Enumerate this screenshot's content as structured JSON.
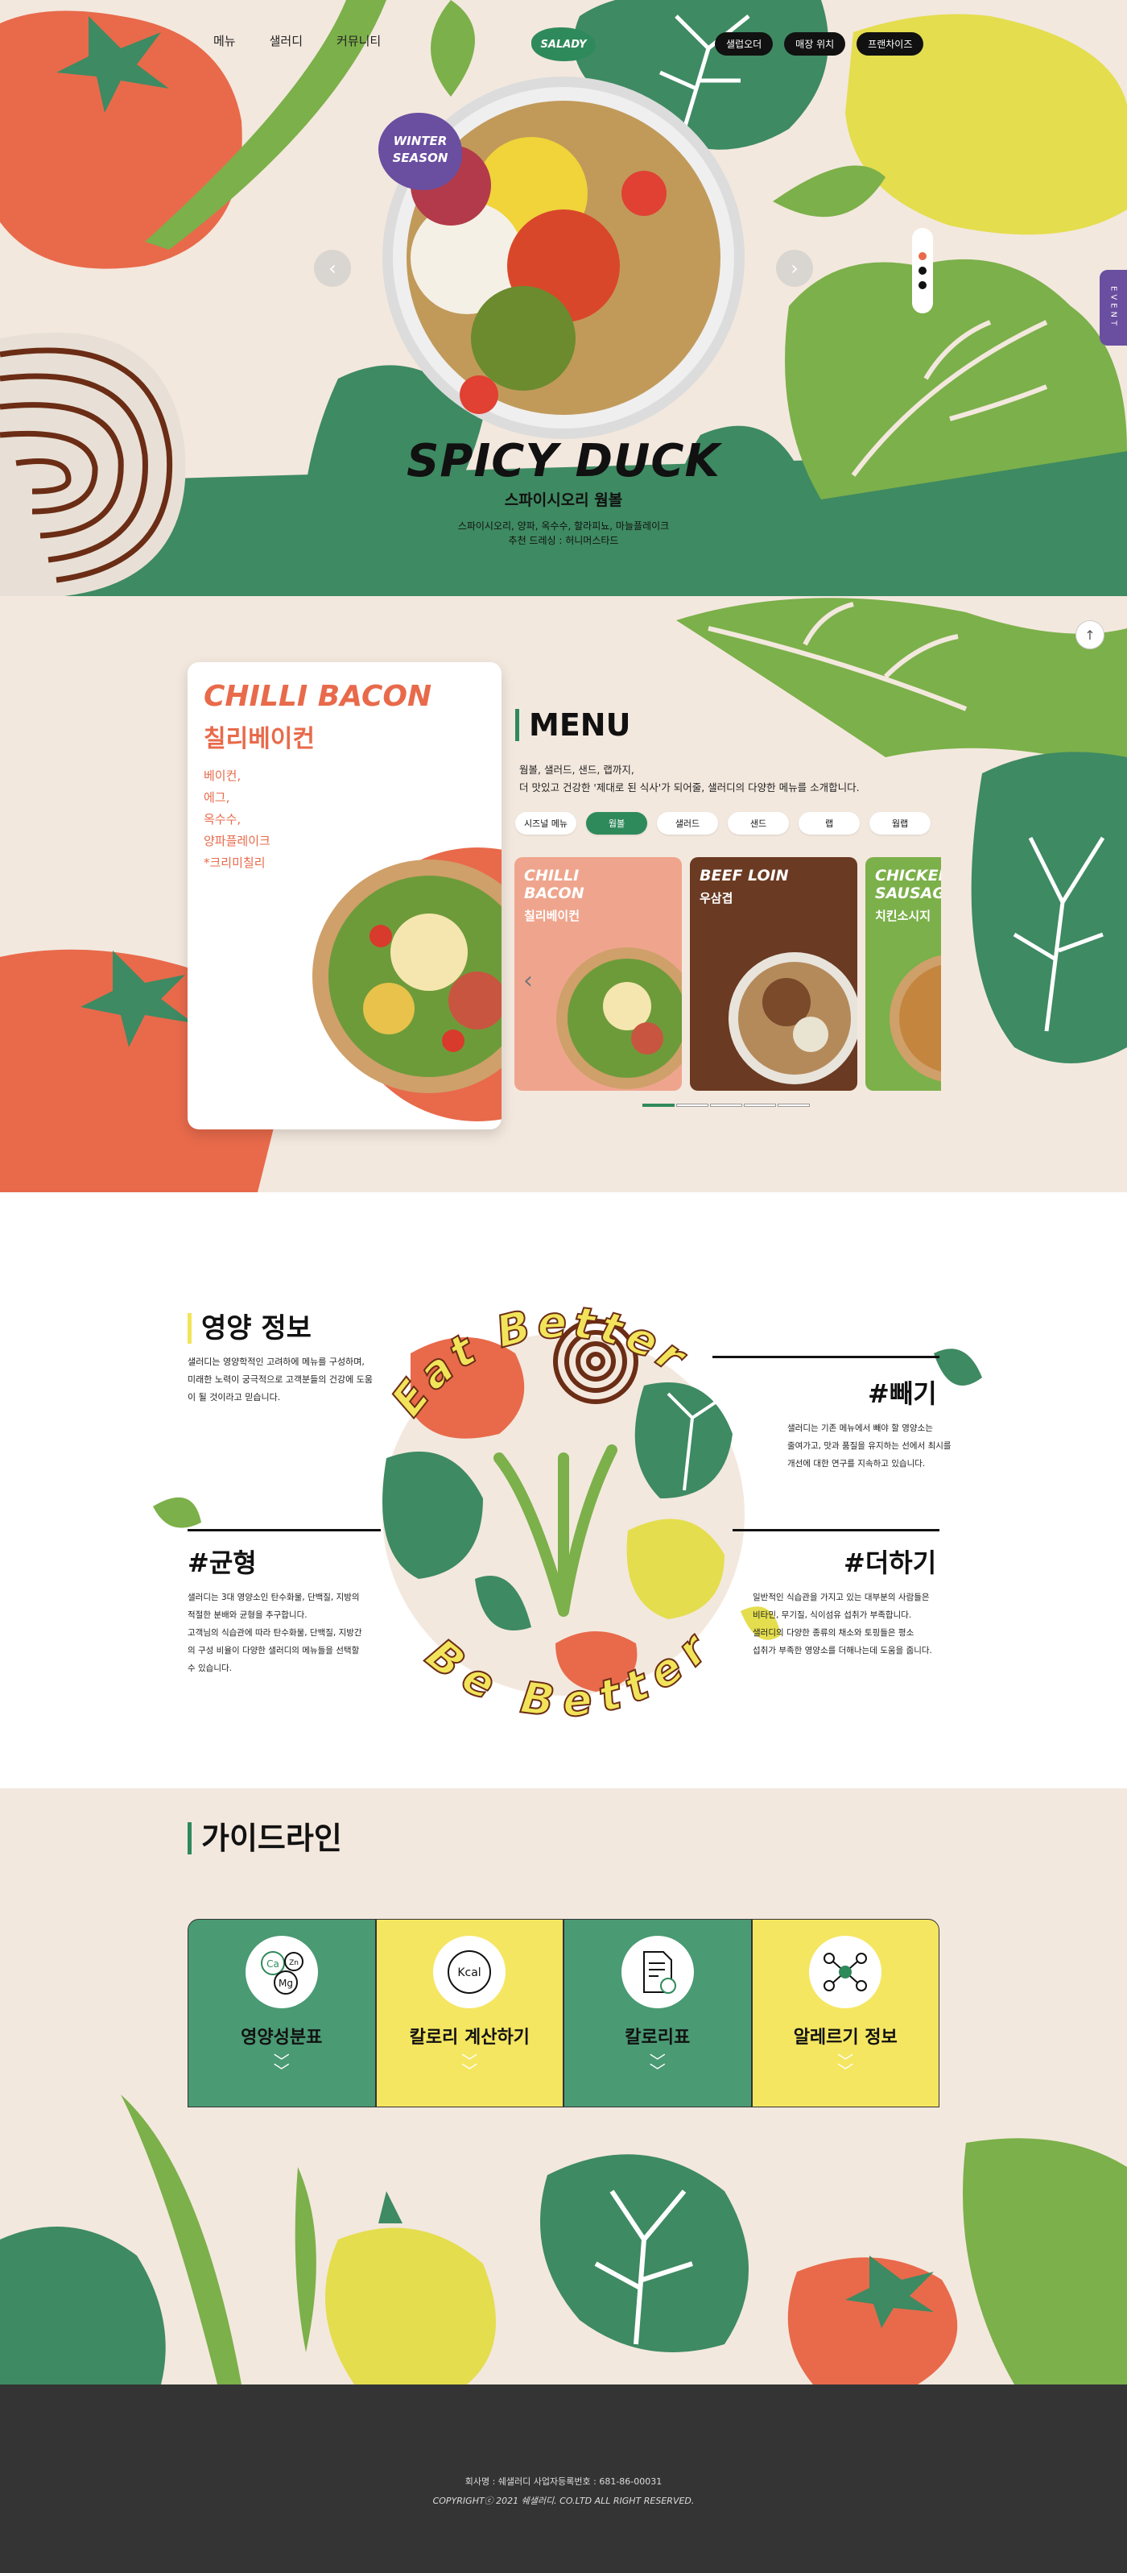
{
  "colors": {
    "green": "#2f8a5b",
    "dark_green": "#3e8a62",
    "orange": "#e86a4b",
    "yellow": "#f2e45a",
    "purple": "#6a4ea0",
    "cream": "#f3e8de",
    "footer": "#343434"
  },
  "nav": {
    "links": [
      "메뉴",
      "샐러디",
      "커뮤니티"
    ],
    "logo": "SALADY",
    "buttons": [
      "샐럽오더",
      "매장 위치",
      "프랜차이즈"
    ]
  },
  "hero": {
    "badge": [
      "WINTER",
      "SEASON"
    ],
    "title": "SPICY DUCK",
    "subtitle": "스파이시오리 웜볼",
    "desc_line1": "스파이시오리, 양파, 옥수수, 할라피뇨, 마늘플레이크",
    "desc_line2": "추천 드레싱 : 허니머스타드",
    "prev_icon": "chevron-left-icon",
    "next_icon": "chevron-right-icon",
    "event_tab": "EVENT"
  },
  "menu": {
    "feature": {
      "en": "CHILLI BACON",
      "ko": "칠리베이컨",
      "ingredients": [
        "베이컨,",
        "에그,",
        "옥수수,",
        "양파플레이크",
        "*크리미칠리"
      ]
    },
    "title": "MENU",
    "desc_line1": "웜볼, 샐러드, 샌드, 랩까지,",
    "desc_line2": "더 맛있고 건강한 '제대로 된 식사'가 되어줄, 샐러디의 다양한 메뉴를 소개합니다.",
    "tabs": [
      "시즈널 메뉴",
      "웜볼",
      "샐러드",
      "샌드",
      "랩",
      "웜랩"
    ],
    "active_tab": "웜볼",
    "cards": [
      {
        "en1": "CHILLI",
        "en2": "BACON",
        "ko": "칠리베이컨",
        "color": "#efa58d"
      },
      {
        "en1": "BEEF LOIN",
        "en2": "",
        "ko": "우삼겹",
        "color": "#6b3a22"
      },
      {
        "en1": "CHICKEN",
        "en2": "SAUSAGE",
        "ko": "치킨소시지",
        "color": "#7cb04a"
      }
    ]
  },
  "nutrition": {
    "title": "영양 정보",
    "desc": [
      "샐러디는 영양학적인 고려하에 메뉴를 구성하며,",
      "미래한 노력이 궁극적으로 고객분들의 건강에 도움",
      "이 될 것이라고 믿습니다."
    ],
    "circle_top": "Eat Better",
    "circle_bottom": "Be Better",
    "items": [
      {
        "tag": "#빼기",
        "desc": [
          "샐러디는 기존 메뉴에서 빼야 할 영양소는",
          "줄여가고, 맛과 품질을 유지하는 선에서 최시를",
          "개선에 대한 연구를 지속하고 있습니다."
        ]
      },
      {
        "tag": "#균형",
        "desc": [
          "샐러디는 3대 영양소인 탄수화물, 단백질, 지방의",
          "적절한 분배와 균형을 추구합니다.",
          "고객님의 식습관에 따라 탄수화물, 단백질, 지방간",
          "의 구성 비율이 다양한 샐러디의 메뉴들을 선택할",
          "수 있습니다."
        ]
      },
      {
        "tag": "#더하기",
        "desc": [
          "일반적인 식습관을 가지고 있는 대부분의 사람들은",
          "비타민, 무기질, 식이섬유 섭취가 부족합니다.",
          "샐러디의 다양한 종류의 채소와 토핑들은 평소",
          "섭취가 부족한 영양소를 더해나는데 도움을 줍니다."
        ]
      }
    ]
  },
  "guide": {
    "title": "가이드라인",
    "cards": [
      {
        "label": "영양성분표",
        "icon": "nutrient-elements-icon",
        "color": "green"
      },
      {
        "label": "칼로리 계산하기",
        "icon": "kcal-icon",
        "color": "yellow"
      },
      {
        "label": "칼로리표",
        "icon": "document-apple-icon",
        "color": "green"
      },
      {
        "label": "알레르기 정보",
        "icon": "molecule-icon",
        "color": "yellow"
      }
    ],
    "icon_texts": {
      "ca": "Ca",
      "zn": "Zn",
      "mg": "Mg",
      "kcal": "Kcal"
    }
  },
  "footer": {
    "line1": "회사명 : 쉐샐러디 사업자등록번호 : 681-86-00031",
    "line2": "COPYRIGHTⓒ 2021 쉐샐러디. CO.LTD ALL RIGHT RESERVED."
  }
}
